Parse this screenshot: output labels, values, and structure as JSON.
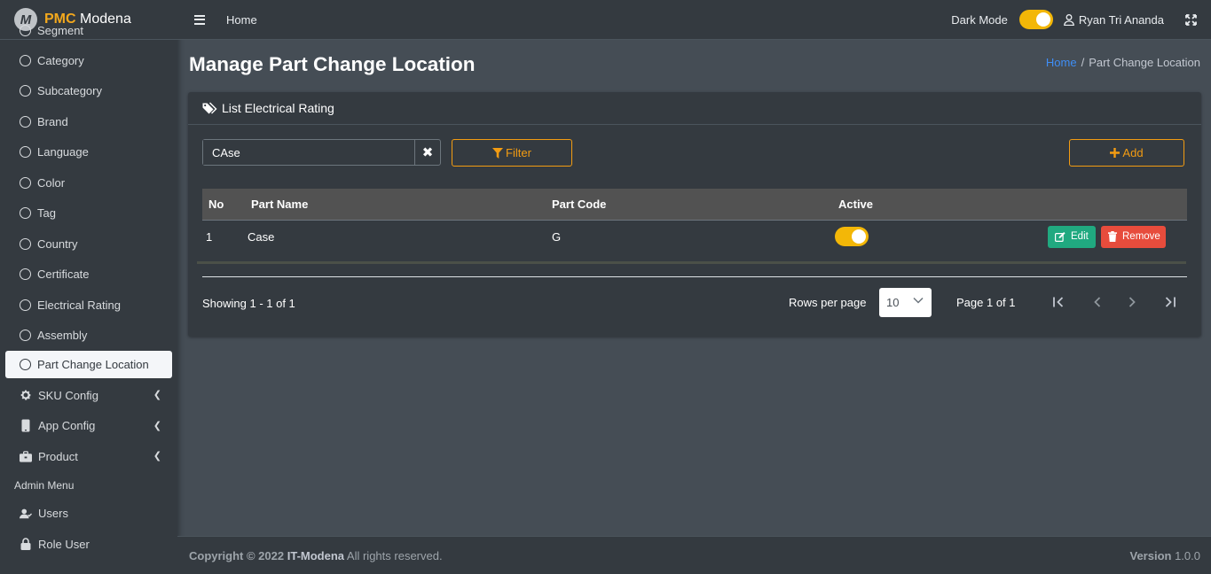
{
  "brand": {
    "logo_letter": "M",
    "name_bold": "PMC",
    "name_rest": "Modena"
  },
  "sidebar": {
    "items": [
      {
        "label": "Segment",
        "icon": "circle-icon"
      },
      {
        "label": "Category",
        "icon": "circle-icon"
      },
      {
        "label": "Subcategory",
        "icon": "circle-icon"
      },
      {
        "label": "Brand",
        "icon": "circle-icon"
      },
      {
        "label": "Language",
        "icon": "circle-icon"
      },
      {
        "label": "Color",
        "icon": "circle-icon"
      },
      {
        "label": "Tag",
        "icon": "circle-icon"
      },
      {
        "label": "Country",
        "icon": "circle-icon"
      },
      {
        "label": "Certificate",
        "icon": "circle-icon"
      },
      {
        "label": "Electrical Rating",
        "icon": "circle-icon"
      },
      {
        "label": "Assembly",
        "icon": "circle-icon"
      },
      {
        "label": "Part Change Location",
        "icon": "circle-icon",
        "active": true
      }
    ],
    "groups": [
      {
        "label": "SKU Config",
        "icon": "gear-icon"
      },
      {
        "label": "App Config",
        "icon": "mobile-icon"
      },
      {
        "label": "Product",
        "icon": "briefcase-icon"
      }
    ],
    "admin_header": "Admin Menu",
    "admin_items": [
      {
        "label": "Users",
        "icon": "users-icon"
      },
      {
        "label": "Role User",
        "icon": "lock-icon"
      }
    ]
  },
  "topbar": {
    "home": "Home",
    "dark_mode_label": "Dark Mode",
    "dark_mode_on": true,
    "user_name": "Ryan Tri Ananda"
  },
  "page": {
    "title": "Manage Part Change Location",
    "breadcrumb_home": "Home",
    "breadcrumb_sep": "/",
    "breadcrumb_current": "Part Change Location"
  },
  "card": {
    "header": "List Electrical Rating",
    "search_value": "CAse",
    "filter_label": "Filter",
    "add_label": "Add"
  },
  "table": {
    "columns": [
      "No",
      "Part Name",
      "Part Code",
      "Active"
    ],
    "rows": [
      {
        "no": "1",
        "part_name": "Case",
        "part_code": "G",
        "active": true,
        "edit_label": "Edit",
        "remove_label": "Remove"
      }
    ]
  },
  "pagination": {
    "showing": "Showing 1 - 1 of 1",
    "rows_per_page_label": "Rows per page",
    "rows_per_page_value": "10",
    "page_info": "Page 1 of 1"
  },
  "footer": {
    "copyright_prefix": "Copyright © 2022",
    "company": "IT-Modena",
    "rights": "All rights reserved.",
    "version_label": "Version",
    "version_value": "1.0.0"
  },
  "colors": {
    "accent": "#f39c12",
    "toggle": "#f3b707",
    "edit": "#20a980",
    "remove": "#e74c3c",
    "link": "#3f8ef5"
  }
}
